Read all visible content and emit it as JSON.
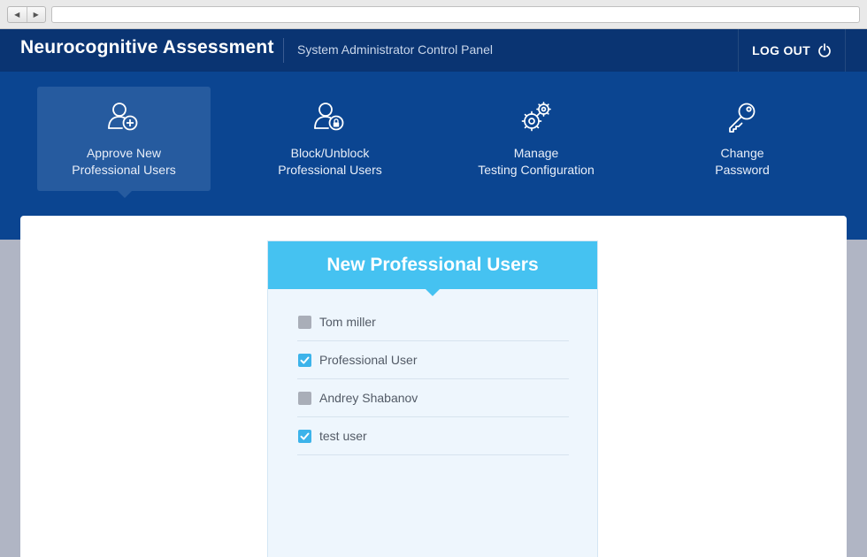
{
  "header": {
    "title": "Neurocognitive Assessment",
    "subtitle": "System Administrator Control Panel",
    "logout_label": "LOG OUT",
    "logout_icon": "power-icon"
  },
  "nav": {
    "items": [
      {
        "line1": "Approve New",
        "line2": "Professional Users",
        "icon": "user-add-icon",
        "active": true
      },
      {
        "line1": "Block/Unblock",
        "line2": "Professional Users",
        "icon": "user-lock-icon",
        "active": false
      },
      {
        "line1": "Manage",
        "line2": "Testing Configuration",
        "icon": "gears-icon",
        "active": false
      },
      {
        "line1": "Change",
        "line2": "Password",
        "icon": "key-icon",
        "active": false
      }
    ]
  },
  "panel": {
    "title": "New Professional Users",
    "users": [
      {
        "name": "Tom miller",
        "checked": false
      },
      {
        "name": "Professional User",
        "checked": true
      },
      {
        "name": "Andrey Shabanov",
        "checked": false
      },
      {
        "name": "test user",
        "checked": true
      }
    ]
  },
  "colors": {
    "header_bg": "#0a3472",
    "nav_bg": "#0b4591",
    "nav_active_bg": "#265b9f",
    "card_header_bg": "#45c2f1",
    "checkbox_checked": "#3cb3ea",
    "checkbox_unchecked": "#a9aeb8"
  }
}
